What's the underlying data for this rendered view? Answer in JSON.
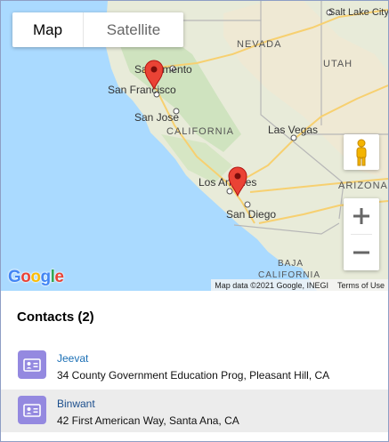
{
  "map": {
    "toggle": {
      "map_label": "Map",
      "satellite_label": "Satellite",
      "selected": "Map"
    },
    "labels": {
      "salt_lake_city": "Salt Lake City",
      "nevada": "NEVADA",
      "utah": "UTAH",
      "sacramento": "Sacramento",
      "san_francisco": "San Francisco",
      "san_jose": "San Jose",
      "california": "CALIFORNIA",
      "las_vegas": "Las Vegas",
      "arizona": "ARIZONA",
      "los_angeles": "Los Angeles",
      "san_diego": "San Diego",
      "baja_california": "BAJA",
      "baja_california_2": "CALIFORNIA"
    },
    "google_logo": "Google",
    "attribution": {
      "data": "Map data ©2021 Google, INEGI",
      "terms": "Terms of Use"
    },
    "colors": {
      "water": "#aadaff",
      "land": "#e8ebd9",
      "marker": "#ea4335"
    }
  },
  "contacts": {
    "title": "Contacts (2)",
    "items": [
      {
        "name": "Jeevat",
        "address": "34 County Government Education Prog, Pleasant Hill, CA"
      },
      {
        "name": "Binwant",
        "address": "42 First American Way, Santa Ana, CA"
      }
    ]
  }
}
